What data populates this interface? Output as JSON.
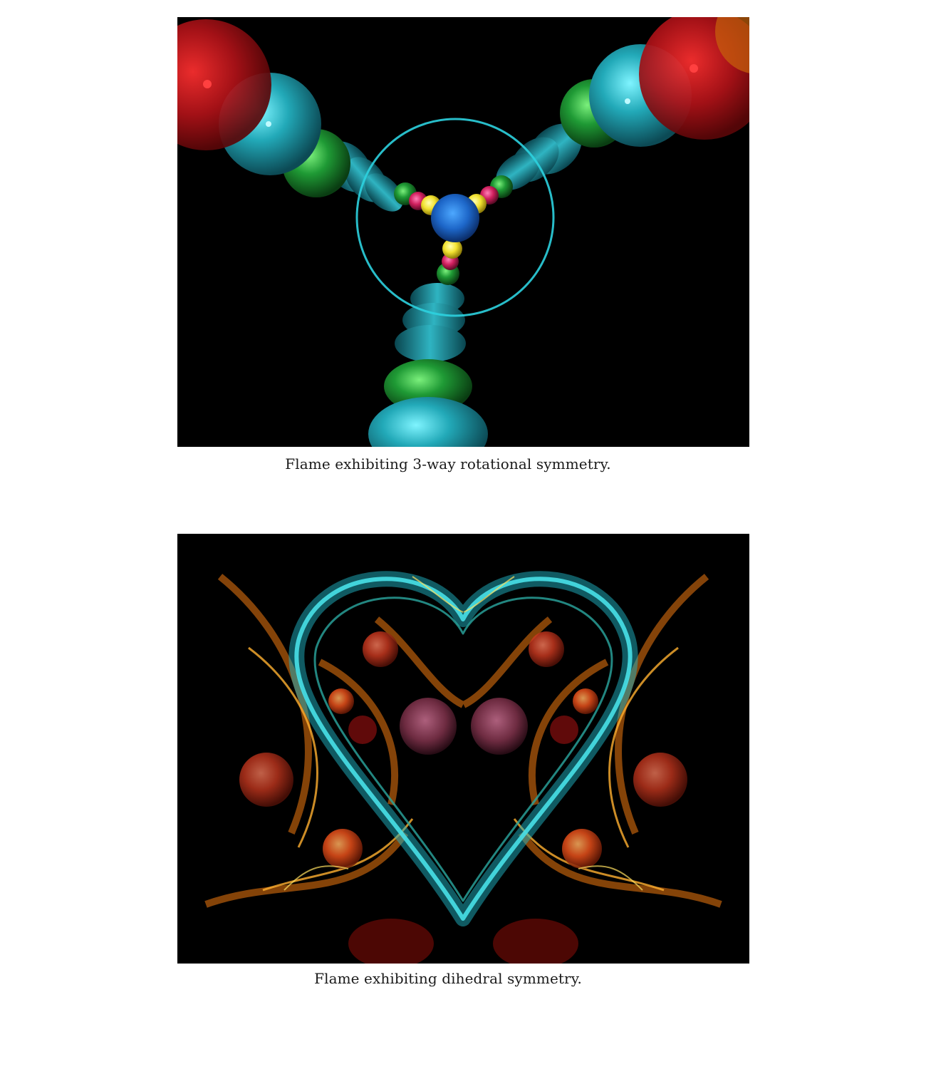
{
  "figures": [
    {
      "image_description_icon": "fractal-flame-rotational",
      "caption": "Flame exhibiting 3-way rotational symmetry."
    },
    {
      "image_description_icon": "fractal-flame-heart",
      "caption": "Flame exhibiting dihedral symmetry."
    }
  ],
  "colors": {
    "background": "#ffffff",
    "caption_text": "#1a1a1a",
    "flame_background": "#000000",
    "cyan": "#1ec8d6",
    "green": "#1fa43a",
    "red": "#d1141c",
    "yellow": "#f2e43a",
    "magenta": "#d3206a",
    "blue": "#2277d6",
    "orange": "#f07a10"
  }
}
